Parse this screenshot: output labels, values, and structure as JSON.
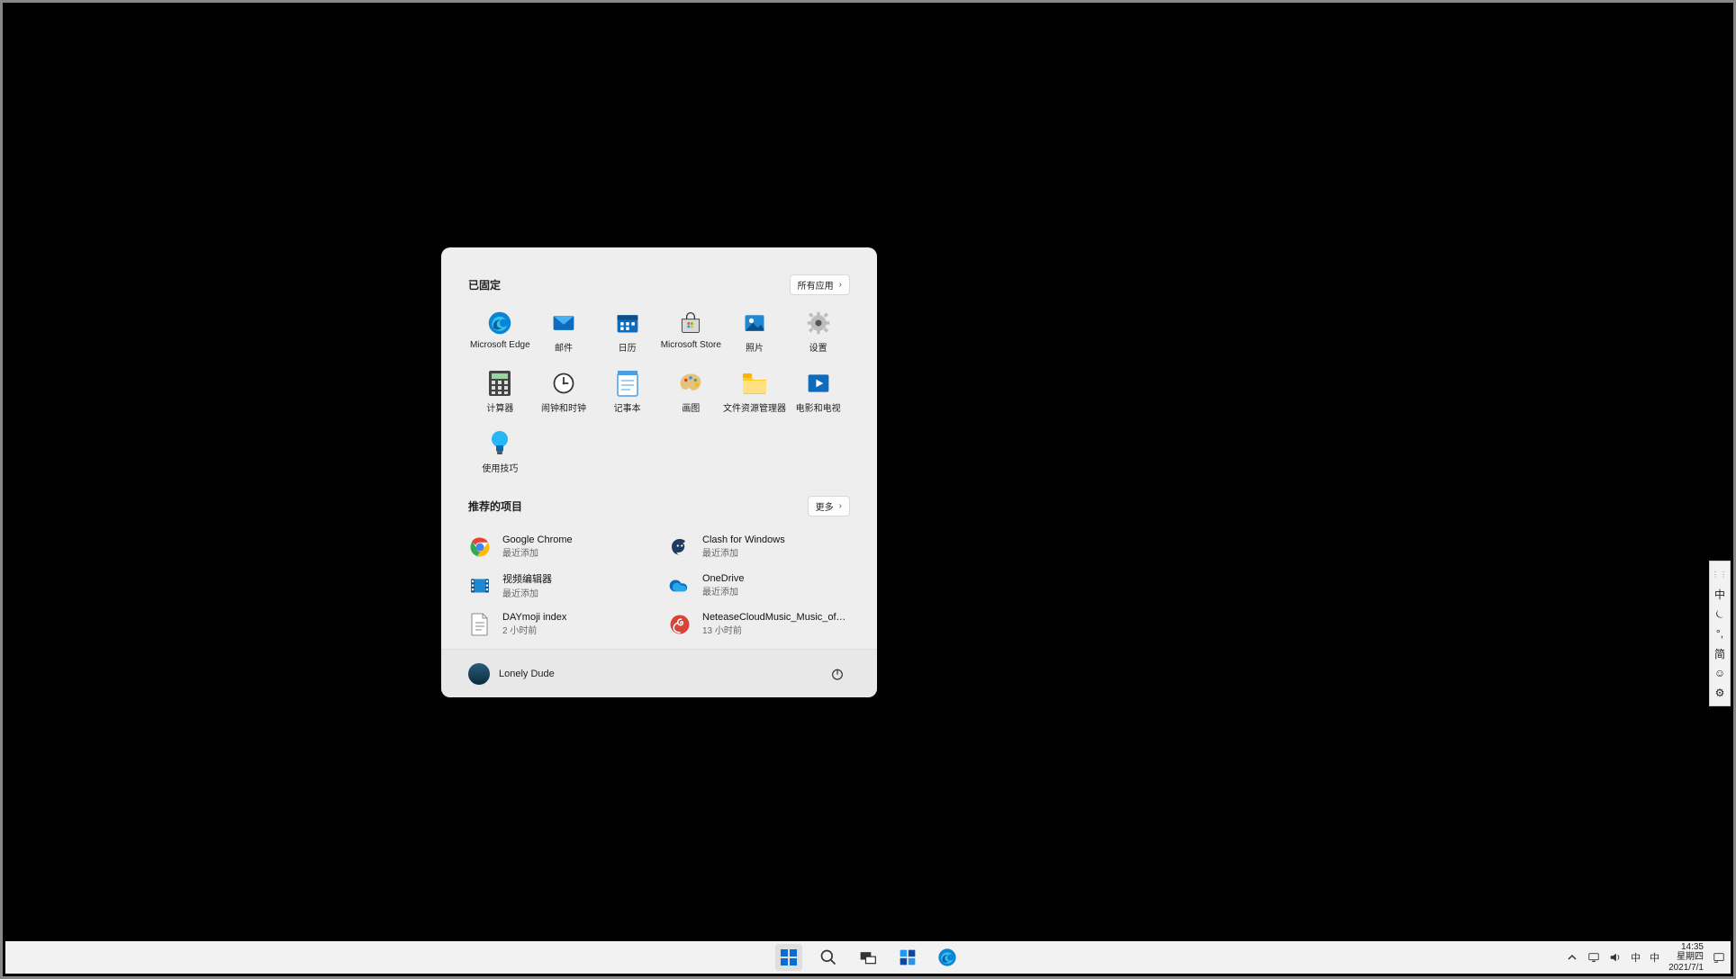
{
  "start": {
    "pinned_header": "已固定",
    "all_apps_label": "所有应用",
    "reco_header": "推荐的项目",
    "more_label": "更多",
    "apps": [
      {
        "label": "Microsoft Edge",
        "icon": "edge"
      },
      {
        "label": "邮件",
        "icon": "mail"
      },
      {
        "label": "日历",
        "icon": "calendar"
      },
      {
        "label": "Microsoft Store",
        "icon": "store"
      },
      {
        "label": "照片",
        "icon": "photos"
      },
      {
        "label": "设置",
        "icon": "settings"
      },
      {
        "label": "计算器",
        "icon": "calculator"
      },
      {
        "label": "闹钟和时钟",
        "icon": "clock"
      },
      {
        "label": "记事本",
        "icon": "notepad"
      },
      {
        "label": "画图",
        "icon": "paint"
      },
      {
        "label": "文件资源管理器",
        "icon": "explorer"
      },
      {
        "label": "电影和电视",
        "icon": "movies"
      },
      {
        "label": "使用技巧",
        "icon": "tips"
      }
    ],
    "reco": [
      {
        "title": "Google Chrome",
        "sub": "最近添加",
        "icon": "chrome"
      },
      {
        "title": "Clash for Windows",
        "sub": "最近添加",
        "icon": "clash"
      },
      {
        "title": "视频编辑器",
        "sub": "最近添加",
        "icon": "videoeditor"
      },
      {
        "title": "OneDrive",
        "sub": "最近添加",
        "icon": "onedrive"
      },
      {
        "title": "DAYmoji index",
        "sub": "2 小时前",
        "icon": "textfile"
      },
      {
        "title": "NeteaseCloudMusic_Music_official_...",
        "sub": "13 小时前",
        "icon": "netease"
      }
    ],
    "user": "Lonely Dude"
  },
  "tray": {
    "time": "14:35",
    "weekday": "星期四",
    "date": "2021/7/1",
    "ime_short1": "中",
    "ime_short2": "中"
  },
  "ime": {
    "items": [
      "中",
      "⏾",
      "°,",
      "简",
      "☺",
      "⚙"
    ]
  }
}
